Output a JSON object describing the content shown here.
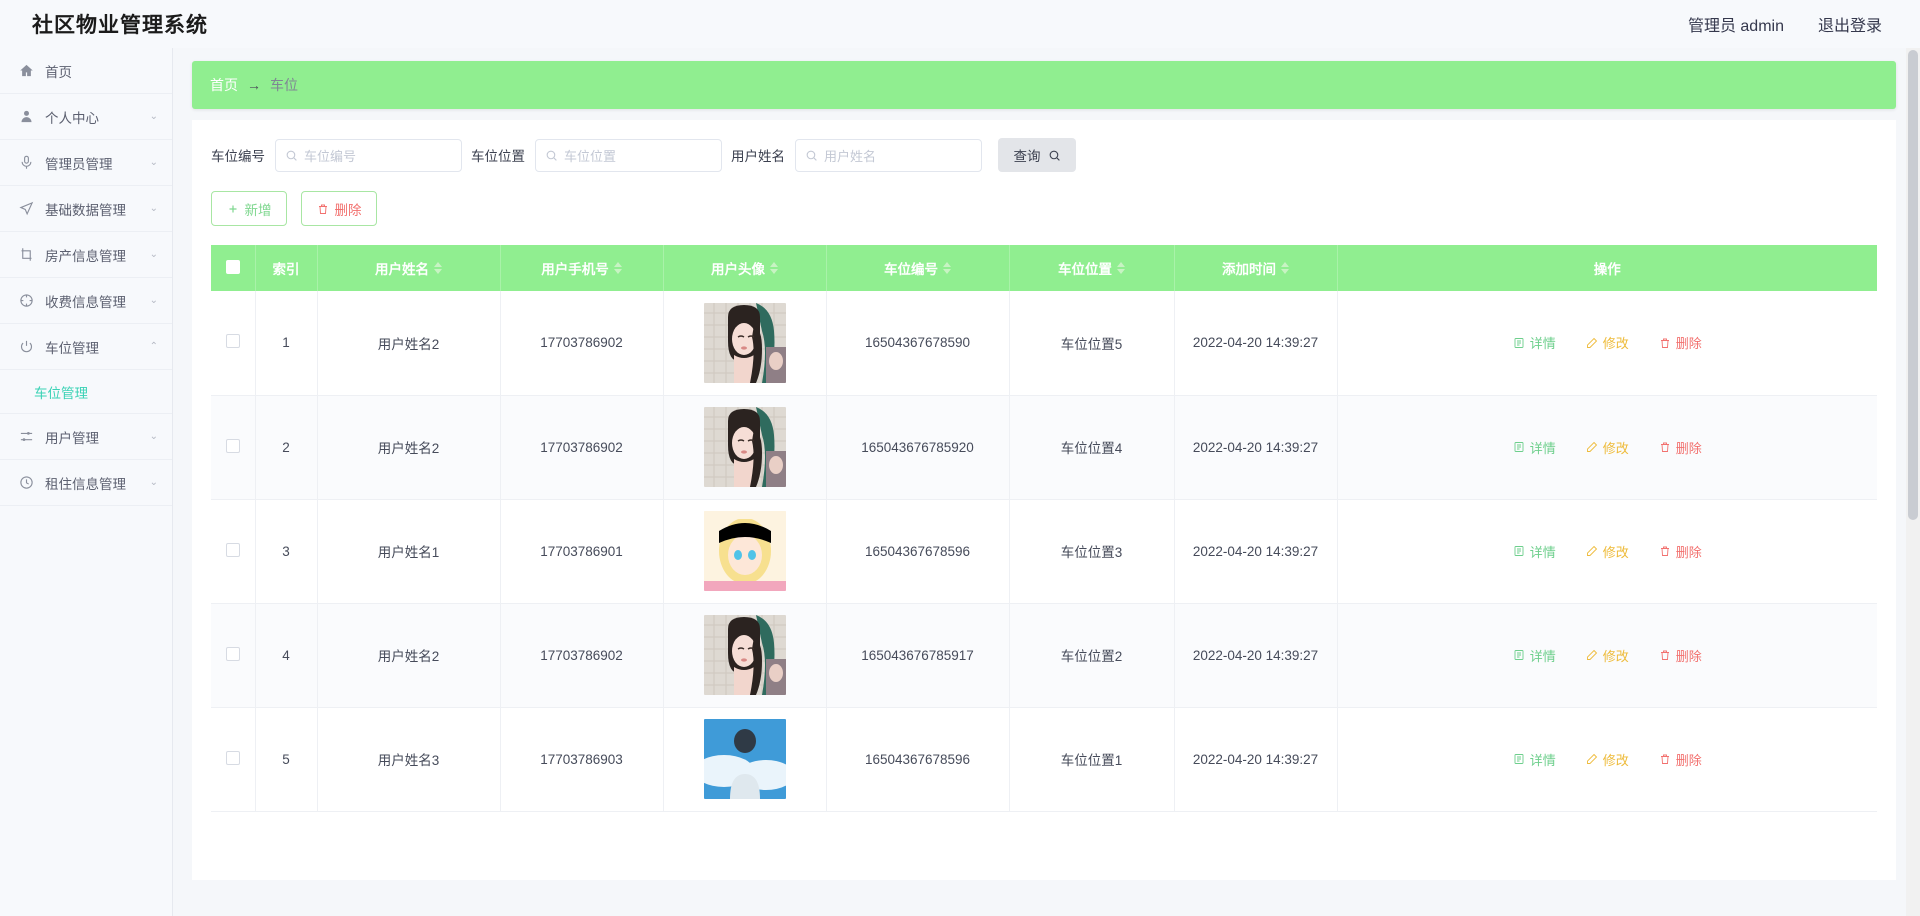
{
  "header": {
    "brand": "社区物业管理系统",
    "admin_label": "管理员 admin",
    "logout_label": "退出登录"
  },
  "sidebar": {
    "items": [
      {
        "label": "首页",
        "icon": "home-icon",
        "expandable": false,
        "arrow": ""
      },
      {
        "label": "个人中心",
        "icon": "user-icon",
        "expandable": true,
        "arrow": "⌄"
      },
      {
        "label": "管理员管理",
        "icon": "mic-icon",
        "expandable": true,
        "arrow": "⌄"
      },
      {
        "label": "基础数据管理",
        "icon": "send-icon",
        "expandable": true,
        "arrow": "⌄"
      },
      {
        "label": "房产信息管理",
        "icon": "crop-icon",
        "expandable": true,
        "arrow": "⌄"
      },
      {
        "label": "收费信息管理",
        "icon": "compass-icon",
        "expandable": true,
        "arrow": "⌄"
      },
      {
        "label": "车位管理",
        "icon": "power-icon",
        "expandable": true,
        "arrow": "⌃"
      }
    ],
    "submenu": {
      "label": "车位管理"
    },
    "items_after": [
      {
        "label": "用户管理",
        "icon": "sliders-icon",
        "expandable": true,
        "arrow": "⌄"
      },
      {
        "label": "租住信息管理",
        "icon": "clock-icon",
        "expandable": true,
        "arrow": "⌄"
      }
    ]
  },
  "breadcrumb": {
    "home": "首页",
    "separator": "→",
    "current": "车位"
  },
  "search": {
    "fields": [
      {
        "label": "车位编号",
        "placeholder": "车位编号",
        "value": "",
        "icon": "search-icon"
      },
      {
        "label": "车位位置",
        "placeholder": "车位位置",
        "value": "",
        "icon": "search-icon"
      },
      {
        "label": "用户姓名",
        "placeholder": "用户姓名",
        "value": "",
        "icon": "search-icon"
      }
    ],
    "query_label": "查询"
  },
  "toolbar": {
    "add_label": "新增",
    "delete_label": "删除"
  },
  "table": {
    "columns": [
      {
        "label": "",
        "sortable": false,
        "name": "select"
      },
      {
        "label": "索引",
        "sortable": false,
        "name": "index"
      },
      {
        "label": "用户姓名",
        "sortable": true,
        "name": "user-name"
      },
      {
        "label": "用户手机号",
        "sortable": true,
        "name": "user-phone"
      },
      {
        "label": "用户头像",
        "sortable": true,
        "name": "user-avatar"
      },
      {
        "label": "车位编号",
        "sortable": true,
        "name": "space-number"
      },
      {
        "label": "车位位置",
        "sortable": true,
        "name": "space-location"
      },
      {
        "label": "添加时间",
        "sortable": true,
        "name": "created-time"
      },
      {
        "label": "操作",
        "sortable": false,
        "name": "operations"
      }
    ],
    "rows": [
      {
        "index": "1",
        "user_name": "用户姓名2",
        "phone": "17703786902",
        "avatar": "woman-green",
        "space_number": "16504367678590",
        "location": "车位位置5",
        "time": "2022-04-20 14:39:27"
      },
      {
        "index": "2",
        "user_name": "用户姓名2",
        "phone": "17703786902",
        "avatar": "woman-green",
        "space_number": "165043676785920",
        "location": "车位位置4",
        "time": "2022-04-20 14:39:27"
      },
      {
        "index": "3",
        "user_name": "用户姓名1",
        "phone": "17703786901",
        "avatar": "blonde-anime",
        "space_number": "16504367678596",
        "location": "车位位置3",
        "time": "2022-04-20 14:39:27"
      },
      {
        "index": "4",
        "user_name": "用户姓名2",
        "phone": "17703786902",
        "avatar": "woman-green",
        "space_number": "165043676785917",
        "location": "车位位置2",
        "time": "2022-04-20 14:39:27"
      },
      {
        "index": "5",
        "user_name": "用户姓名3",
        "phone": "17703786903",
        "avatar": "sky-boy",
        "space_number": "16504367678596",
        "location": "车位位置1",
        "time": "2022-04-20 14:39:27"
      }
    ],
    "operations": {
      "detail_label": "详情",
      "edit_label": "修改",
      "delete_label": "删除"
    }
  },
  "colors": {
    "primary_green": "#90ee90",
    "accent_teal": "#3ad2b5",
    "danger_red": "#f2706e",
    "warn_yellow": "#eebb3a",
    "detail_green": "#6dcf8c"
  }
}
